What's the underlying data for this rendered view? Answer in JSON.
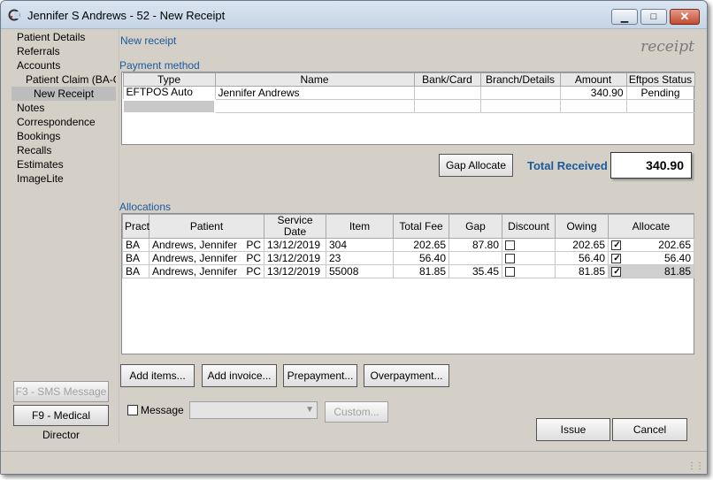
{
  "window": {
    "title": "Jennifer S Andrews - 52 - New Receipt",
    "min_glyph": "▁",
    "max_glyph": "□",
    "close_glyph": "✕"
  },
  "sidebar": {
    "items": [
      {
        "label": "Patient Details"
      },
      {
        "label": "Referrals"
      },
      {
        "label": "Accounts"
      },
      {
        "label": "Patient Claim (BA-CN"
      },
      {
        "label": "New Receipt"
      },
      {
        "label": "Notes"
      },
      {
        "label": "Correspondence"
      },
      {
        "label": "Bookings"
      },
      {
        "label": "Recalls"
      },
      {
        "label": "Estimates"
      },
      {
        "label": "ImageLite"
      }
    ],
    "sms_button": "F3 - SMS Message",
    "md_button": "F9 - Medical Director"
  },
  "main": {
    "header_link": "New receipt",
    "header_word": "receipt",
    "payment_method_label": "Payment method",
    "payment_columns": [
      "Type",
      "Name",
      "Bank/Card",
      "Branch/Details",
      "Amount",
      "Eftpos Status"
    ],
    "payment_rows": [
      {
        "type": "EFTPOS Auto",
        "name": "Jennifer Andrews",
        "bank": "",
        "branch": "",
        "amount": "340.90",
        "status": "Pending"
      }
    ],
    "gap_allocate_button": "Gap Allocate",
    "total_label": "Total Received",
    "total_value": "340.90",
    "allocations_label": "Allocations",
    "alloc_columns": [
      "Pract",
      "Patient",
      "Service Date",
      "Item",
      "Total Fee",
      "Gap",
      "Discount",
      "Owing",
      "Allocate"
    ],
    "alloc_rows": [
      {
        "pract": "BA",
        "patient": "Andrews, Jennifer",
        "pc": "PC",
        "date": "13/12/2019",
        "item": "304",
        "fee": "202.65",
        "gap": "87.80",
        "discount": false,
        "owing": "202.65",
        "allocate_checked": true,
        "allocate": "202.65"
      },
      {
        "pract": "BA",
        "patient": "Andrews, Jennifer",
        "pc": "PC",
        "date": "13/12/2019",
        "item": "23",
        "fee": "56.40",
        "gap": "",
        "discount": false,
        "owing": "56.40",
        "allocate_checked": true,
        "allocate": "56.40"
      },
      {
        "pract": "BA",
        "patient": "Andrews, Jennifer",
        "pc": "PC",
        "date": "13/12/2019",
        "item": "55008",
        "fee": "81.85",
        "gap": "35.45",
        "discount": false,
        "owing": "81.85",
        "allocate_checked": true,
        "allocate": "81.85"
      }
    ],
    "buttons": {
      "add_items": "Add items...",
      "add_invoice": "Add invoice...",
      "prepayment": "Prepayment...",
      "overpayment": "Overpayment...",
      "custom": "Custom...",
      "issue": "Issue",
      "cancel": "Cancel"
    },
    "message_label": "Message",
    "message_value": ""
  },
  "colors": {
    "accent": "#1a5a9a",
    "window_bg": "#d4d0c8",
    "selected_nav": "#bcbcbc"
  }
}
